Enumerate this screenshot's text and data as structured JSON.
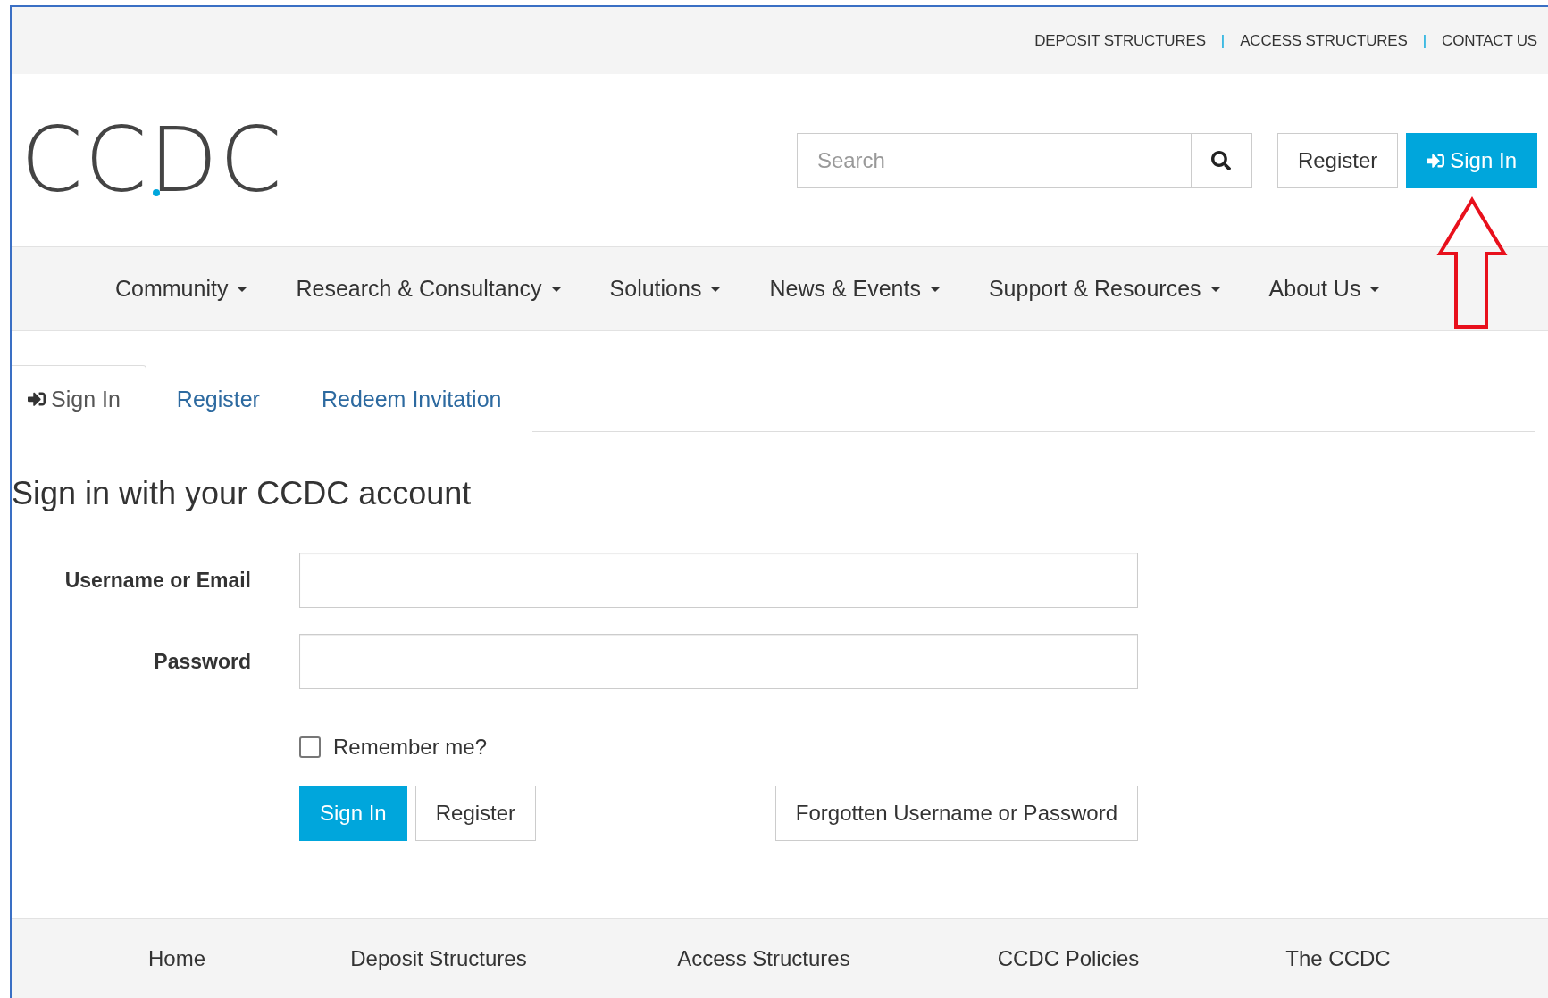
{
  "top_bar": {
    "items": [
      {
        "kind": "link",
        "text": "DEPOSIT STRUCTURES"
      },
      {
        "kind": "separator",
        "text": "|"
      },
      {
        "kind": "link",
        "text": "ACCESS STRUCTURES"
      },
      {
        "kind": "separator",
        "text": "|"
      },
      {
        "kind": "link",
        "text": "CONTACT US"
      }
    ]
  },
  "header": {
    "logo": "CCDC",
    "search": {
      "placeholder": "Search"
    },
    "buttons": [
      {
        "label": "Register",
        "kind": "default",
        "icon": false
      },
      {
        "label": "Sign In",
        "kind": "primary",
        "icon": true
      }
    ]
  },
  "nav": {
    "items": [
      {
        "label": "Community",
        "dropdown": true
      },
      {
        "label": "Research & Consultancy",
        "dropdown": true
      },
      {
        "label": "Solutions",
        "dropdown": true
      },
      {
        "label": "News & Events",
        "dropdown": true
      },
      {
        "label": "Support & Resources",
        "dropdown": true
      },
      {
        "label": "About Us",
        "dropdown": true
      }
    ]
  },
  "tabs": [
    {
      "label": "Sign In",
      "selected": true,
      "icon": true
    },
    {
      "label": "Register",
      "selected": false,
      "icon": false
    },
    {
      "label": "Redeem Invitation",
      "selected": false,
      "icon": false
    }
  ],
  "form": {
    "title": "Sign in with your CCDC account",
    "fields": [
      {
        "label": "Username or Email"
      },
      {
        "label": "Password"
      }
    ],
    "remember": {
      "label": "Remember me?",
      "checked": false
    },
    "buttons": [
      {
        "label": "Sign In",
        "kind": "primary"
      },
      {
        "label": "Register",
        "kind": "default"
      }
    ],
    "forgot": "Forgotten Username or Password"
  },
  "footer": {
    "links": [
      "Home",
      "Deposit Structures",
      "Access Structures",
      "CCDC Policies",
      "The CCDC"
    ]
  }
}
